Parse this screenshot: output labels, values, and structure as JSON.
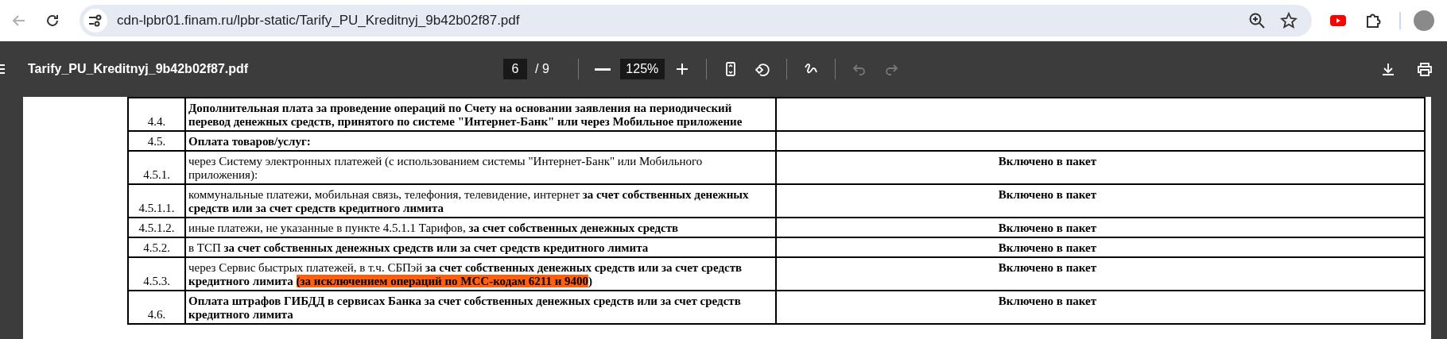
{
  "browser": {
    "back_disabled": true,
    "url": "cdn-lpbr01.finam.ru/lpbr-static/Tarify_PU_Kreditnyj_9b42b02f87.pdf"
  },
  "pdf_toolbar": {
    "title": "Tarify_PU_Kreditnyj_9b42b02f87.pdf",
    "page": "6",
    "page_count": "/ 9",
    "zoom": "125%",
    "undo_disabled": true,
    "redo_disabled": true
  },
  "table": {
    "rows": [
      {
        "number": "4.4.",
        "description": [
          {
            "kind": "bold",
            "text": "Дополнительная плата за проведение операций по Счету на основании заявления на периодический перевод денежных средств, принятого по системе \"Интернет-Банк\" или через Мобильное приложение"
          }
        ]
      },
      {
        "number": "4.5.",
        "description": [
          {
            "kind": "bold",
            "text": "Оплата товаров/услуг:"
          }
        ]
      },
      {
        "number": "4.5.1.",
        "description": [
          {
            "kind": "normal",
            "text": "через Систему электронных платежей (с использованием системы \"Интернет-Банк\" или Мобильного приложения):"
          }
        ],
        "value": "Включено в пакет"
      },
      {
        "number": "4.5.1.1.",
        "description": [
          {
            "kind": "normal",
            "text": "коммунальные платежи, мобильная связь, телефония, телевидение, интернет "
          },
          {
            "kind": "bold",
            "text": "за счет собственных денежных средств или за счет средств кредитного лимита"
          }
        ],
        "value": "Включено в пакет"
      },
      {
        "number": "4.5.1.2.",
        "description": [
          {
            "kind": "normal",
            "text": "иные платежи, не указанные в пункте 4.5.1.1 Тарифов, "
          },
          {
            "kind": "bold",
            "text": "за счет собственных денежных средств"
          }
        ],
        "value": "Включено в пакет"
      },
      {
        "number": "4.5.2.",
        "description": [
          {
            "kind": "normal",
            "text": "в ТСП "
          },
          {
            "kind": "bold",
            "text": "за счет собственных денежных средств или за счет средств кредитного лимита"
          }
        ],
        "value": "Включено в пакет"
      },
      {
        "number": "4.5.3.",
        "description": [
          {
            "kind": "normal",
            "text": "через Сервис быстрых платежей, в т.ч. СБПэй "
          },
          {
            "kind": "bold",
            "text": "за счет собственных денежных средств или за счет средств кредитного лимита "
          },
          {
            "kind": "highlight",
            "text": "(за исключением операций по МСС-кодам 6211 и 9400"
          },
          {
            "kind": "bold",
            "text": ")"
          }
        ],
        "value": "Включено в пакет"
      },
      {
        "number": "4.6.",
        "description": [
          {
            "kind": "bold",
            "text": "Оплата штрафов ГИБДД в сервисах Банка за счет собственных денежных средств или за счет средств кредитного лимита"
          }
        ],
        "value": "Включено в пакет"
      }
    ]
  }
}
